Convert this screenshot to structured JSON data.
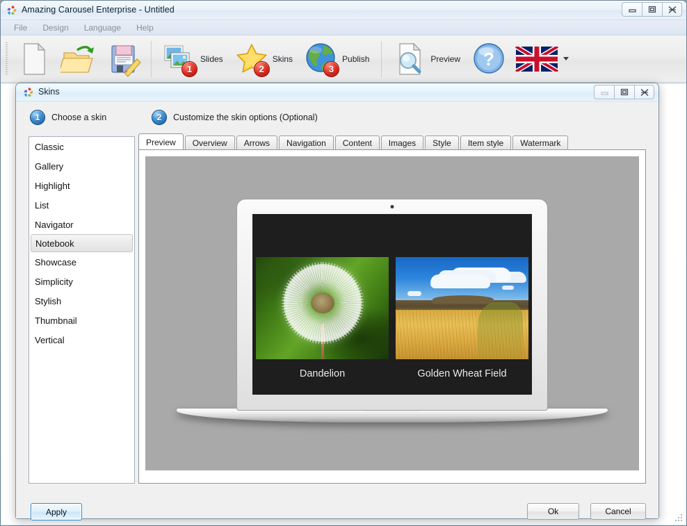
{
  "main_window": {
    "title": "Amazing Carousel Enterprise - Untitled",
    "logo_icon": "carousel-swirl-logo",
    "controls": [
      {
        "name": "minimize",
        "icon": "minimize-icon"
      },
      {
        "name": "restore",
        "icon": "restore-icon"
      },
      {
        "name": "close",
        "icon": "close-icon"
      }
    ]
  },
  "menubar": {
    "items": [
      {
        "label": "File"
      },
      {
        "label": "Design"
      },
      {
        "label": "Language"
      },
      {
        "label": "Help"
      }
    ]
  },
  "toolbar": {
    "buttons": [
      {
        "label": "",
        "icon": "new-document-icon",
        "badge": ""
      },
      {
        "label": "",
        "icon": "open-folder-icon",
        "badge": ""
      },
      {
        "label": "",
        "icon": "save-floppy-icon",
        "badge": ""
      },
      {
        "label": "Slides",
        "icon": "slides-images-icon",
        "badge": "1"
      },
      {
        "label": "Skins",
        "icon": "star-icon",
        "badge": "2"
      },
      {
        "label": "Publish",
        "icon": "globe-icon",
        "badge": "3"
      },
      {
        "label": "Preview",
        "icon": "preview-magnifier-icon",
        "badge": ""
      },
      {
        "label": "",
        "icon": "help-question-icon",
        "badge": ""
      },
      {
        "label": "",
        "icon": "uk-flag-icon",
        "badge": ""
      }
    ]
  },
  "dialog": {
    "title": "Skins",
    "logo_icon": "carousel-swirl-logo",
    "controls": [
      {
        "name": "minimize",
        "icon": "minimize-icon"
      },
      {
        "name": "restore",
        "icon": "restore-icon"
      },
      {
        "name": "close",
        "icon": "close-icon"
      }
    ],
    "steps": [
      {
        "number": "1",
        "label": "Choose a skin"
      },
      {
        "number": "2",
        "label": "Customize the skin options (Optional)"
      }
    ],
    "skin_list": {
      "selected": "Notebook",
      "items": [
        {
          "label": "Classic"
        },
        {
          "label": "Gallery"
        },
        {
          "label": "Highlight"
        },
        {
          "label": "List"
        },
        {
          "label": "Navigator"
        },
        {
          "label": "Notebook"
        },
        {
          "label": "Showcase"
        },
        {
          "label": "Simplicity"
        },
        {
          "label": "Stylish"
        },
        {
          "label": "Thumbnail"
        },
        {
          "label": "Vertical"
        }
      ]
    },
    "tabs": [
      {
        "label": "Preview",
        "active": true
      },
      {
        "label": "Overview",
        "active": false
      },
      {
        "label": "Arrows",
        "active": false
      },
      {
        "label": "Navigation",
        "active": false
      },
      {
        "label": "Content",
        "active": false
      },
      {
        "label": "Images",
        "active": false
      },
      {
        "label": "Style",
        "active": false
      },
      {
        "label": "Item style",
        "active": false
      },
      {
        "label": "Watermark",
        "active": false
      }
    ],
    "preview": {
      "device": "laptop-notebook-mockup",
      "background_color": "#a9a9a9",
      "screen_color": "#1e1e1e",
      "slides": [
        {
          "caption": "Dandelion",
          "image": "dandelion-photo"
        },
        {
          "caption": "Golden Wheat Field",
          "image": "wheat-field-photo"
        }
      ]
    },
    "buttons": {
      "apply": "Apply",
      "ok": "Ok",
      "cancel": "Cancel"
    }
  }
}
